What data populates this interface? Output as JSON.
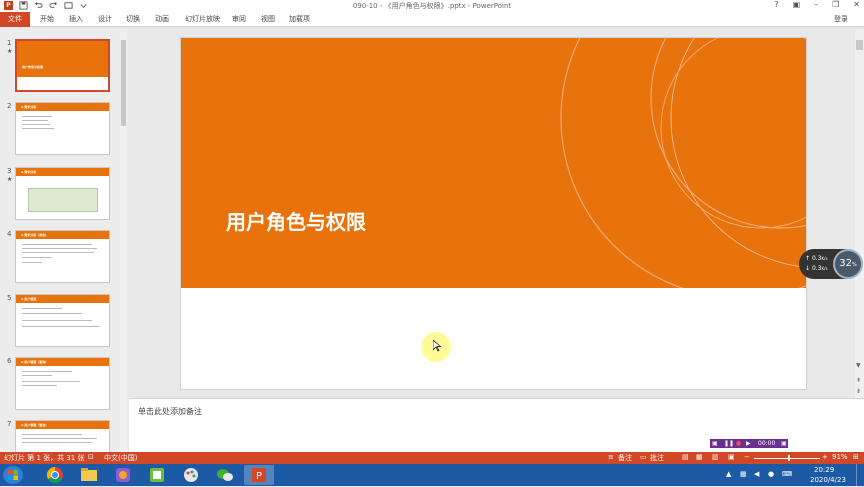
{
  "app": {
    "doc_title": "090-10 - 《用户角色与权限》.pptx - PowerPoint",
    "login": "登录"
  },
  "ribbon": {
    "file": "文件",
    "tabs": [
      "开始",
      "插入",
      "设计",
      "切换",
      "动画",
      "幻灯片放映",
      "审阅",
      "视图",
      "加载项"
    ]
  },
  "thumbnails": [
    {
      "num": "1",
      "star": "★",
      "title": "用户角色与权限"
    },
    {
      "num": "2",
      "star": "",
      "title": "1.需求分析"
    },
    {
      "num": "3",
      "star": "★",
      "title": "1.需求分析"
    },
    {
      "num": "4",
      "star": "",
      "title": "1.需求分析（角色）"
    },
    {
      "num": "5",
      "star": "",
      "title": "1.用户管理"
    },
    {
      "num": "6",
      "star": "",
      "title": "1.用户管理（查询）"
    },
    {
      "num": "7",
      "star": "",
      "title": "1.用户管理（查询）"
    }
  ],
  "slide": {
    "title": "用户角色与权限"
  },
  "notes": {
    "placeholder": "单击此处添加备注"
  },
  "speed_meter": {
    "up": "0.3",
    "down": "0.3",
    "unit": "K/s",
    "percent": "32",
    "percent_sign": "%"
  },
  "recorder": {
    "time": "00:00"
  },
  "status": {
    "slide_info": "幻灯片 第 1 张，共 31 张",
    "language": "中文(中国)",
    "notes_btn": "备注",
    "comments_btn": "批注",
    "zoom": "91%"
  },
  "tray": {
    "time": "20:29",
    "date": "2020/4/23"
  },
  "colors": {
    "accent": "#d24726",
    "slide_orange": "#e8720c",
    "taskbar": "#1c5aa6"
  }
}
